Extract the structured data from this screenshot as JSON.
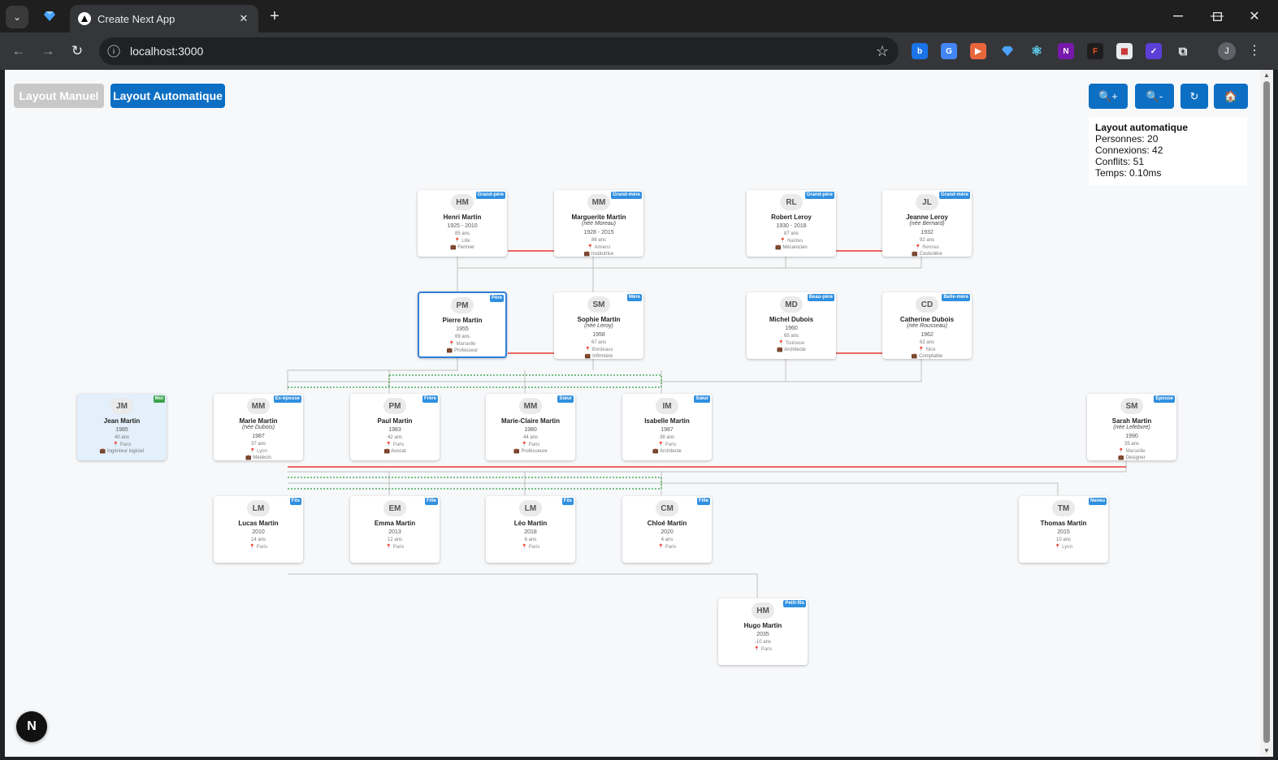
{
  "browser": {
    "tab_title": "Create Next App",
    "url": "localhost:3000",
    "profile_initial": "J",
    "window_controls": [
      "minimize",
      "maximize",
      "close"
    ]
  },
  "controls": {
    "layout_manual": "Layout Manuel",
    "layout_auto": "Layout Automatique",
    "zoom_in": "🔍+",
    "zoom_out": "🔍-",
    "reset": "↻",
    "home": "🏠"
  },
  "stats": {
    "title": "Layout automatique",
    "persons": "Personnes: 20",
    "connections": "Connexions: 42",
    "conflicts": "Conflits: 51",
    "time": "Temps: 0.10ms"
  },
  "colors": {
    "marriage_line": "#e53935",
    "sibling_line": "#2e9e44",
    "parent_line": "#bfbfbf",
    "accent": "#0d6fc4"
  },
  "persons": [
    {
      "id": "henri",
      "initials": "HM",
      "name": "Henri Martin",
      "maiden": "",
      "dates": "1925 - 2010",
      "age": "85 ans",
      "place": "Lille",
      "job": "Fermier",
      "badge": "Grand-père"
    },
    {
      "id": "marguerite",
      "initials": "MM",
      "name": "Marguerite Martin",
      "maiden": "(née Moreau)",
      "dates": "1928 - 2015",
      "age": "86 ans",
      "place": "Amiens",
      "job": "Institutrice",
      "badge": "Grand-mère"
    },
    {
      "id": "robert",
      "initials": "RL",
      "name": "Robert Leroy",
      "maiden": "",
      "dates": "1930 - 2018",
      "age": "87 ans",
      "place": "Nantes",
      "job": "Mécanicien",
      "badge": "Grand-père"
    },
    {
      "id": "jeanne",
      "initials": "JL",
      "name": "Jeanne Leroy",
      "maiden": "(née Bernard)",
      "dates": "1932",
      "age": "92 ans",
      "place": "Rennes",
      "job": "Couturière",
      "badge": "Grand-mère"
    },
    {
      "id": "pierre",
      "initials": "PM",
      "name": "Pierre Martin",
      "maiden": "",
      "dates": "1955",
      "age": "69 ans",
      "place": "Marseille",
      "job": "Professeur",
      "badge": "Père"
    },
    {
      "id": "sophie",
      "initials": "SM",
      "name": "Sophie Martin",
      "maiden": "(née Leroy)",
      "dates": "1958",
      "age": "67 ans",
      "place": "Bordeaux",
      "job": "Infirmière",
      "badge": "Mère"
    },
    {
      "id": "michel",
      "initials": "MD",
      "name": "Michel Dubois",
      "maiden": "",
      "dates": "1960",
      "age": "65 ans",
      "place": "Toulouse",
      "job": "Architecte",
      "badge": "Beau-père"
    },
    {
      "id": "catherine",
      "initials": "CD",
      "name": "Catherine Dubois",
      "maiden": "(née Rousseau)",
      "dates": "1962",
      "age": "62 ans",
      "place": "Nice",
      "job": "Comptable",
      "badge": "Belle-mère"
    },
    {
      "id": "jean",
      "initials": "JM",
      "name": "Jean Martin",
      "maiden": "",
      "dates": "1985",
      "age": "40 ans",
      "place": "Paris",
      "job": "Ingénieur logiciel",
      "badge": "Moi"
    },
    {
      "id": "marie",
      "initials": "MM",
      "name": "Marie Martin",
      "maiden": "(née Dubois)",
      "dates": "1987",
      "age": "37 ans",
      "place": "Lyon",
      "job": "Médecin",
      "badge": "Ex-épouse"
    },
    {
      "id": "paul",
      "initials": "PM",
      "name": "Paul Martin",
      "maiden": "",
      "dates": "1983",
      "age": "42 ans",
      "place": "Paris",
      "job": "Avocat",
      "badge": "Frère"
    },
    {
      "id": "marieclaire",
      "initials": "MM",
      "name": "Marie-Claire Martin",
      "maiden": "",
      "dates": "1980",
      "age": "44 ans",
      "place": "Paris",
      "job": "Professeure",
      "badge": "Sœur"
    },
    {
      "id": "isabelle",
      "initials": "IM",
      "name": "Isabelle Martin",
      "maiden": "",
      "dates": "1987",
      "age": "38 ans",
      "place": "Paris",
      "job": "Architecte",
      "badge": "Sœur"
    },
    {
      "id": "sarah",
      "initials": "SM",
      "name": "Sarah Martin",
      "maiden": "(née Lefebvre)",
      "dates": "1990",
      "age": "35 ans",
      "place": "Marseille",
      "job": "Designer",
      "badge": "Épouse"
    },
    {
      "id": "lucas",
      "initials": "LM",
      "name": "Lucas Martin",
      "maiden": "",
      "dates": "2010",
      "age": "14 ans",
      "place": "Paris",
      "job": "",
      "badge": "Fils"
    },
    {
      "id": "emma",
      "initials": "EM",
      "name": "Emma Martin",
      "maiden": "",
      "dates": "2013",
      "age": "12 ans",
      "place": "Paris",
      "job": "",
      "badge": "Fille"
    },
    {
      "id": "leo",
      "initials": "LM",
      "name": "Léo Martin",
      "maiden": "",
      "dates": "2018",
      "age": "6 ans",
      "place": "Paris",
      "job": "",
      "badge": "Fils"
    },
    {
      "id": "chloe",
      "initials": "CM",
      "name": "Chloé Martin",
      "maiden": "",
      "dates": "2020",
      "age": "4 ans",
      "place": "Paris",
      "job": "",
      "badge": "Fille"
    },
    {
      "id": "thomas",
      "initials": "TM",
      "name": "Thomas Martin",
      "maiden": "",
      "dates": "2015",
      "age": "10 ans",
      "place": "Lyon",
      "job": "",
      "badge": "Neveu"
    },
    {
      "id": "hugo",
      "initials": "HM",
      "name": "Hugo Martin",
      "maiden": "",
      "dates": "2035",
      "age": "-10 ans",
      "place": "Paris",
      "job": "",
      "badge": "Petit-fils"
    }
  ],
  "dev_badge": "N"
}
